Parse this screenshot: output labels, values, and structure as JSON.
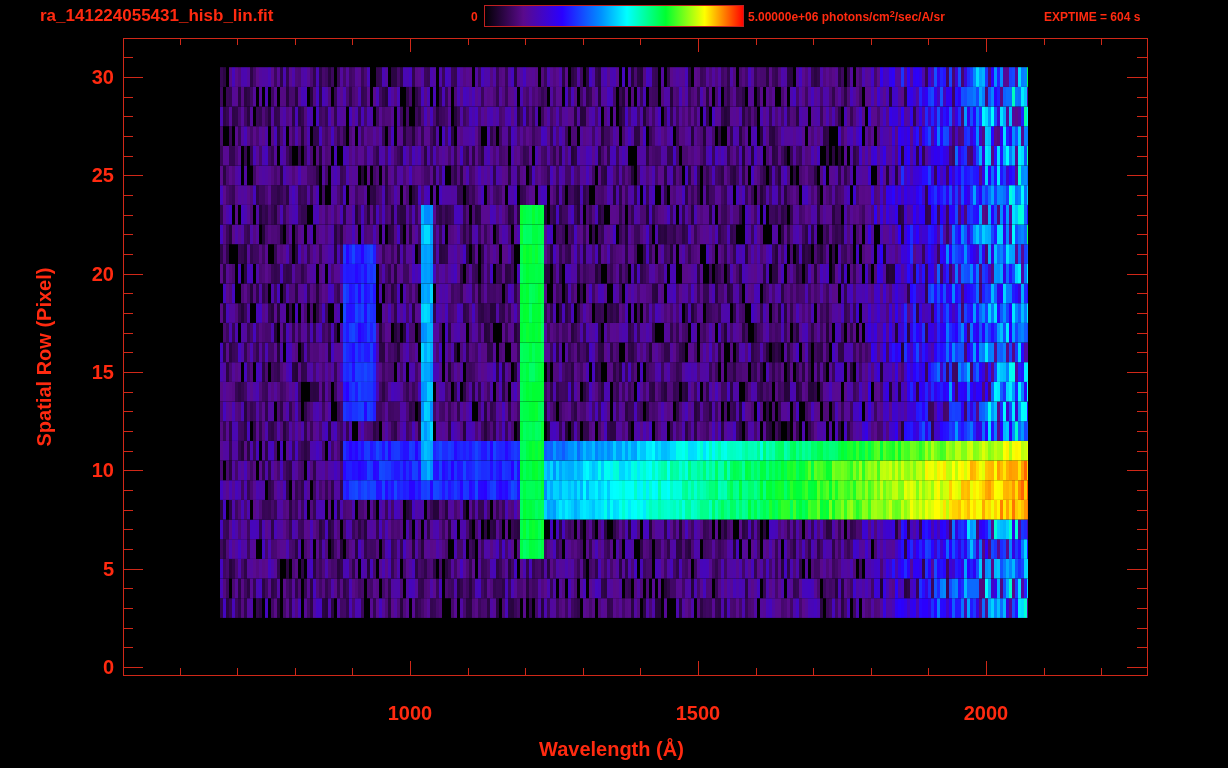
{
  "header": {
    "file_name": "ra_141224055431_hisb_lin.fit",
    "colorbar_min": "0",
    "colorbar_max": "5.00000e+06 photons/cm$^{2}$/sec/A/sr",
    "exposure": "EXPTIME = 604 s"
  },
  "plot": {
    "xlabel": "Wavelength (Å)",
    "ylabel": "Spatial Row (Pixel)",
    "xticks": [
      "1000",
      "1500",
      "2000"
    ],
    "yticks": [
      "30",
      "25",
      "20",
      "15",
      "10",
      "5",
      "0"
    ]
  }
}
